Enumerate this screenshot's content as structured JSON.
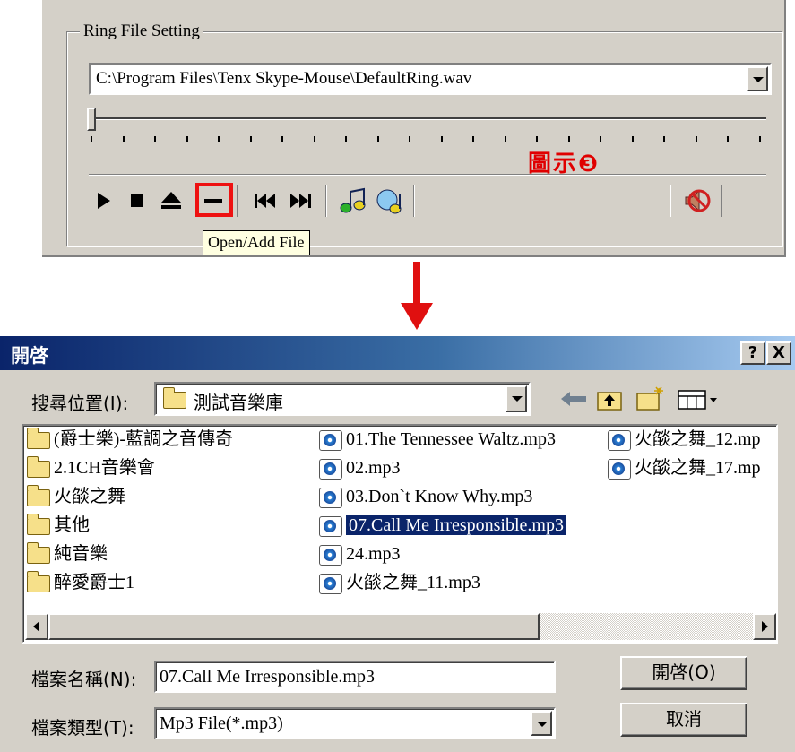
{
  "ring_setting": {
    "group_title": "Ring File Setting",
    "file_path": "C:\\Program Files\\Tenx Skype-Mouse\\DefaultRing.wav",
    "caption": "圖示❸",
    "tooltip": "Open/Add File",
    "toolbar_icons": [
      "play-icon",
      "stop-icon",
      "eject-icon",
      "minus-icon",
      "previous-track-icon",
      "next-track-icon",
      "music-note-green-icon",
      "music-note-blue-icon",
      "speaker-mute-icon"
    ]
  },
  "dialog": {
    "title": "開啓",
    "help_btn": "?",
    "close_btn": "X",
    "look_in_label": "搜尋位置(I):",
    "look_in_value": "測試音樂庫",
    "files_col1": [
      "(爵士樂)-藍調之音傳奇",
      "2.1CH音樂會",
      "火燄之舞",
      "其他",
      "純音樂",
      "醉愛爵士1"
    ],
    "files_col2": [
      "01.The Tennessee Waltz.mp3",
      "02.mp3",
      "03.Don`t Know Why.mp3",
      "07.Call Me Irresponsible.mp3",
      "24.mp3",
      "火燄之舞_11.mp3"
    ],
    "files_col3": [
      "火燄之舞_12.mp",
      "火燄之舞_17.mp"
    ],
    "filename_label": "檔案名稱(N):",
    "filename_value": "07.Call Me Irresponsible.mp3",
    "filetype_label": "檔案類型(T):",
    "filetype_value": "Mp3 File(*.mp3)",
    "open_button": "開啓(O)",
    "cancel_button": "取消"
  },
  "colors": {
    "highlight_red": "#ee1111",
    "caption_red": "#e00000",
    "title_bar": "#0a246a",
    "window_face": "#d4d0c8"
  }
}
